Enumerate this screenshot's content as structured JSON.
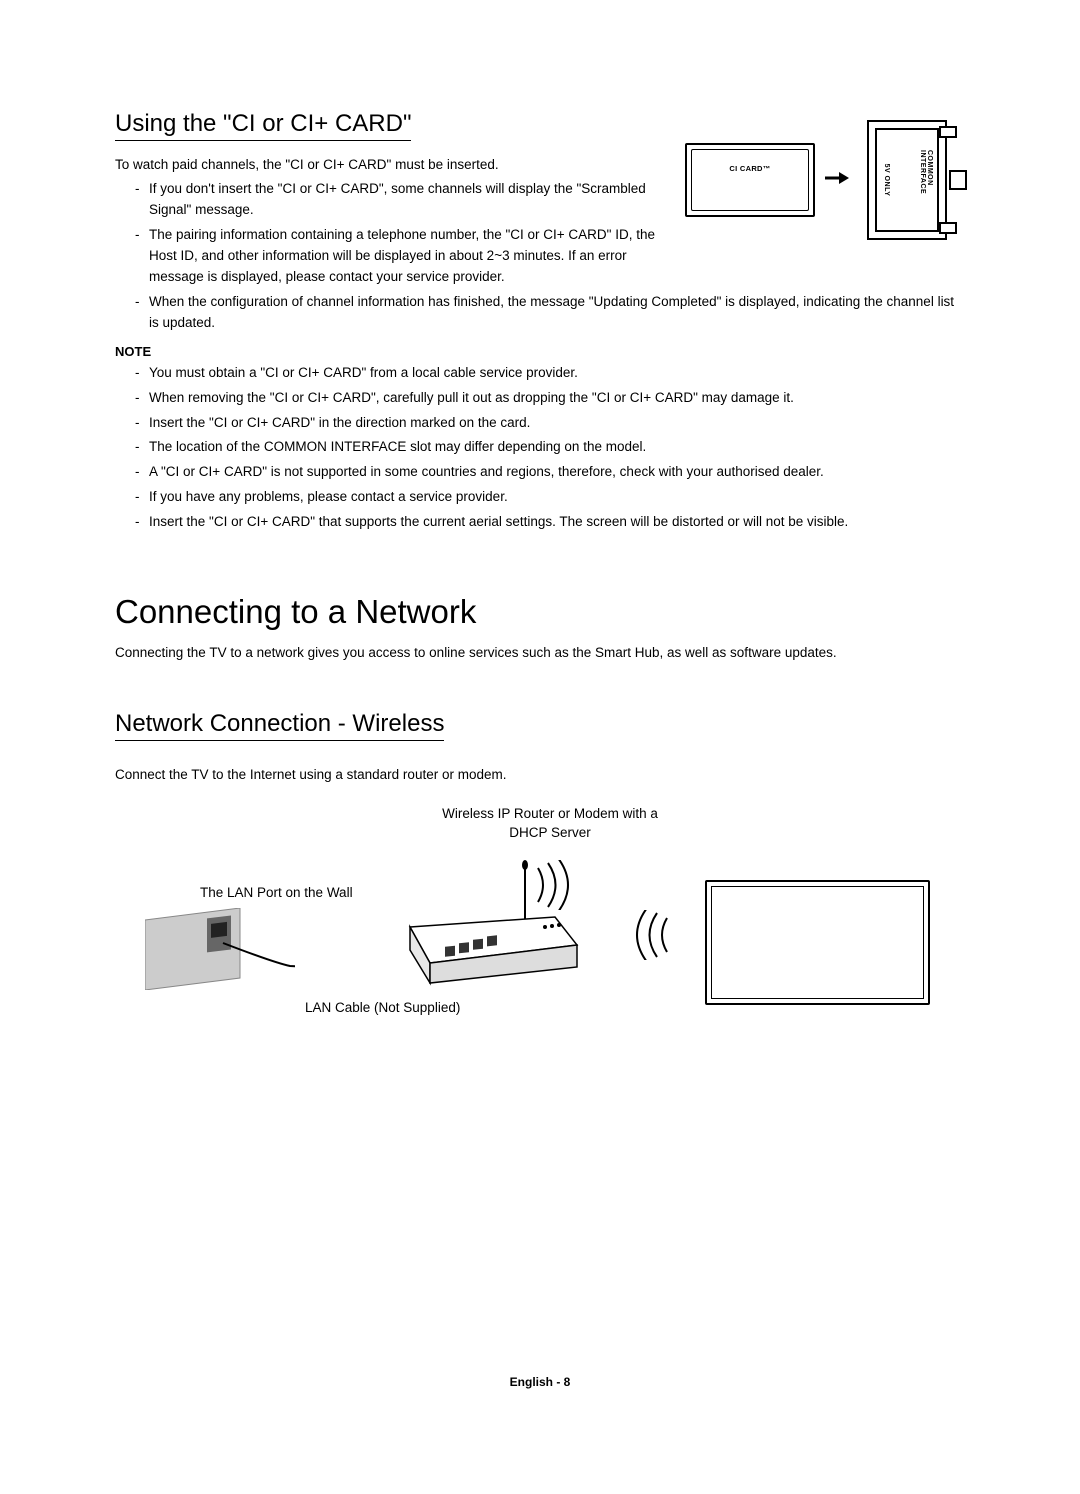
{
  "section1": {
    "heading": "Using the \"CI or CI+ CARD\"",
    "intro": "To watch paid channels, the \"CI or CI+ CARD\" must be inserted.",
    "bullets_top": [
      "If you don't insert the \"CI or CI+ CARD\", some channels will display the \"Scrambled Signal\" message.",
      "The pairing information containing a telephone number, the \"CI or CI+ CARD\" ID, the Host ID, and other information will be displayed in about 2~3 minutes. If an error message is displayed, please contact your service provider.",
      "When the configuration of channel information has finished, the message \"Updating Completed\" is displayed, indicating the channel list is updated."
    ],
    "note_label": "NOTE",
    "note_bullets": [
      "You must obtain a \"CI or CI+ CARD\" from a local cable service provider.",
      "When removing the \"CI or CI+ CARD\", carefully pull it out as dropping the \"CI or CI+ CARD\" may damage it.",
      "Insert the \"CI or CI+ CARD\" in the direction marked on the card.",
      "The location of the COMMON INTERFACE slot may differ depending on the model.",
      "A \"CI or CI+ CARD\" is not supported in some countries and regions, therefore, check with your authorised dealer.",
      "If you have any problems, please contact a service provider.",
      "Insert the \"CI or CI+ CARD\" that supports the current aerial settings. The screen will be distorted or will not be visible."
    ],
    "diagram": {
      "card_label": "CI CARD™",
      "slot_left": "5V ONLY",
      "slot_right": "COMMON INTERFACE"
    }
  },
  "section2": {
    "heading": "Connecting to a Network",
    "body": "Connecting the TV to a network gives you access to online services such as the Smart Hub, as well as software updates."
  },
  "section3": {
    "heading": "Network Connection - Wireless",
    "body": "Connect the TV to the Internet using a standard router or modem.",
    "diagram": {
      "router_label": "Wireless IP Router or Modem with a DHCP Server",
      "lan_port_label": "The LAN Port on the Wall",
      "lan_cable_label": "LAN Cable (Not Supplied)"
    }
  },
  "footer": "English - 8"
}
